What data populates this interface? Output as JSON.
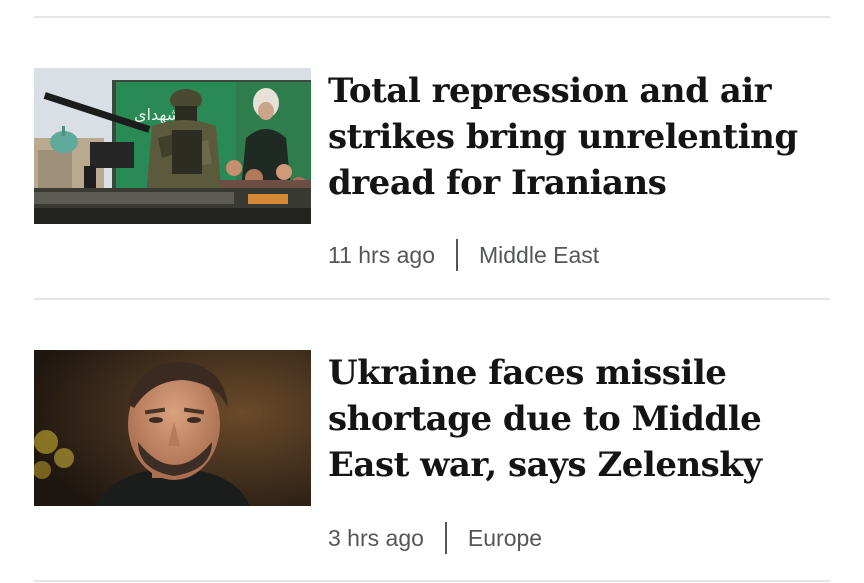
{
  "articles": [
    {
      "headline": "Total repression and air strikes bring unrelenting dread for Iranians",
      "time": "11 hrs ago",
      "section": "Middle East",
      "image_alt": "Armed soldier in front of a large billboard portrait in Tehran",
      "image_text": "شهدای"
    },
    {
      "headline": "Ukraine faces missile shortage due to Middle East war, says Zelensky",
      "time": "3 hrs ago",
      "section": "Europe",
      "image_alt": "Portrait of Volodymyr Zelensky"
    }
  ],
  "colors": {
    "headline": "#141414",
    "meta": "#545658",
    "divider": "#e6e6e6",
    "background": "#ffffff"
  }
}
